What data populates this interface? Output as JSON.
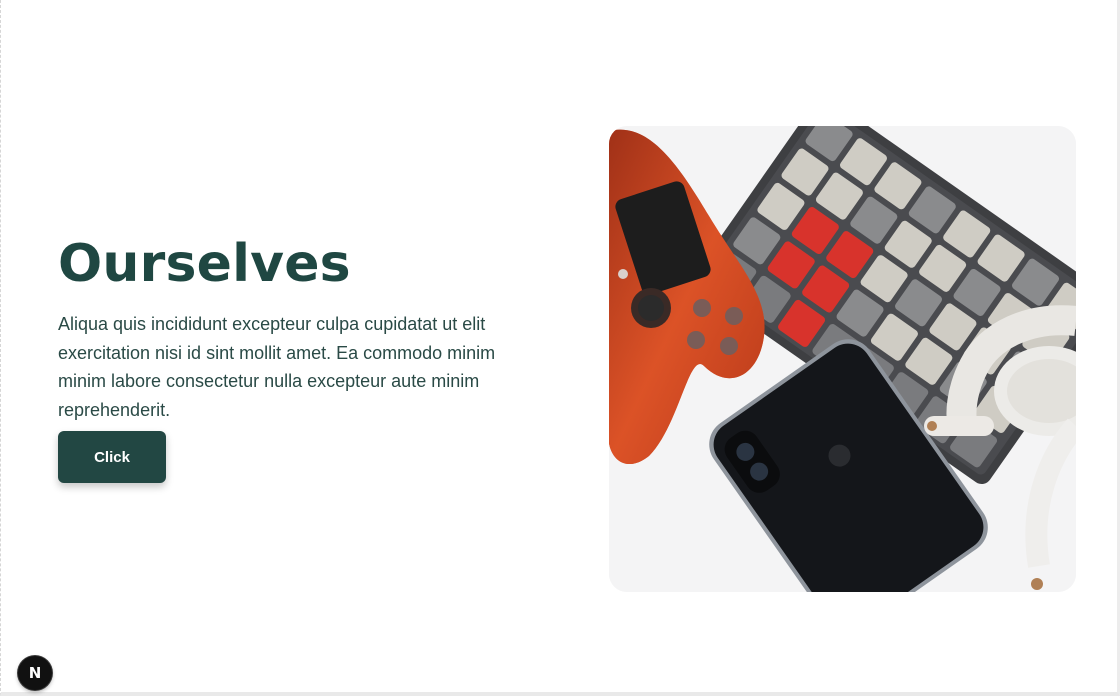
{
  "hero": {
    "title": "Ourselves",
    "body": "Aliqua quis incididunt excepteur culpa cupidatat ut elit exercitation nisi id sint mollit amet. Ea commodo minim minim labore consectetur nulla excepteur aute minim reprehenderit.",
    "button_label": "Click",
    "image": {
      "description_icon": "gaming-desk-photo"
    }
  },
  "dev_indicator": {
    "letter": "N",
    "icon": "nextjs-logo-icon"
  },
  "colors": {
    "heading": "#1f4742",
    "body_text": "#2a4a46",
    "button_bg": "#224743",
    "button_text": "#ffffff",
    "accent_red": "#d8332c"
  }
}
